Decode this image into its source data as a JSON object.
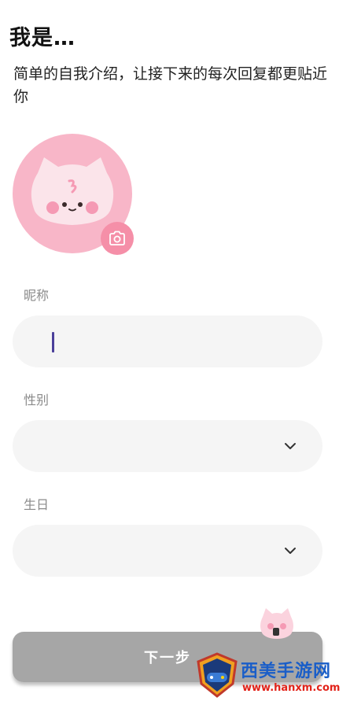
{
  "header": {
    "title": "我是…",
    "subtitle": "简单的自我介绍，让接下来的每次回复都更贴近你"
  },
  "avatar": {
    "icon": "kitten-avatar",
    "camera_icon": "camera-icon",
    "bg_color": "#f8b6c8",
    "camera_color": "#f58fa8"
  },
  "form": {
    "nickname": {
      "label": "昵称",
      "value": ""
    },
    "gender": {
      "label": "性别",
      "value": ""
    },
    "birthday": {
      "label": "生日",
      "value": ""
    }
  },
  "actions": {
    "next_label": "下一步"
  },
  "watermark": {
    "name": "西美手游网",
    "url": "www.hanxm.com"
  }
}
